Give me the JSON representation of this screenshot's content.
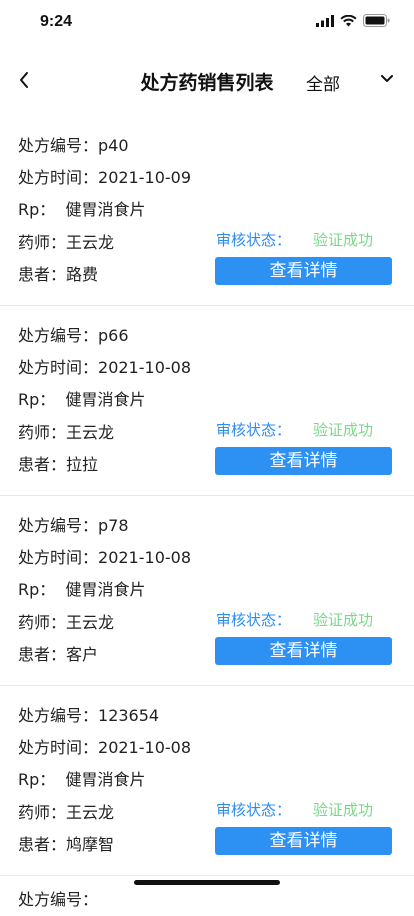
{
  "status_bar": {
    "time": "9:24"
  },
  "header": {
    "title": "处方药销售列表",
    "filter": "全部"
  },
  "records": [
    {
      "code_label": "处方编号：",
      "code": "p40",
      "time_label": "处方时间：",
      "time": "2021-10-09",
      "rp_label": "Rp：",
      "rp": "健胃消食片",
      "pharmacist_label": "药师：",
      "pharmacist": "王云龙",
      "patient_label": "患者：",
      "patient": "路费",
      "status_label": "审核状态：",
      "status": "验证成功",
      "button": "查看详情"
    },
    {
      "code_label": "处方编号：",
      "code": "p66",
      "time_label": "处方时间：",
      "time": "2021-10-08",
      "rp_label": "Rp：",
      "rp": "健胃消食片",
      "pharmacist_label": "药师：",
      "pharmacist": "王云龙",
      "patient_label": "患者：",
      "patient": "拉拉",
      "status_label": "审核状态：",
      "status": "验证成功",
      "button": "查看详情"
    },
    {
      "code_label": "处方编号：",
      "code": "p78",
      "time_label": "处方时间：",
      "time": "2021-10-08",
      "rp_label": "Rp：",
      "rp": "健胃消食片",
      "pharmacist_label": "药师：",
      "pharmacist": "王云龙",
      "patient_label": "患者：",
      "patient": "客户",
      "status_label": "审核状态：",
      "status": "验证成功",
      "button": "查看详情"
    },
    {
      "code_label": "处方编号：",
      "code": "123654",
      "time_label": "处方时间：",
      "time": "2021-10-08",
      "rp_label": "Rp：",
      "rp": "健胃消食片",
      "pharmacist_label": "药师：",
      "pharmacist": "王云龙",
      "patient_label": "患者：",
      "patient": "鸠摩智",
      "status_label": "审核状态：",
      "status": "验证成功",
      "button": "查看详情"
    }
  ],
  "partial_record": {
    "code_label": "处方编号："
  }
}
